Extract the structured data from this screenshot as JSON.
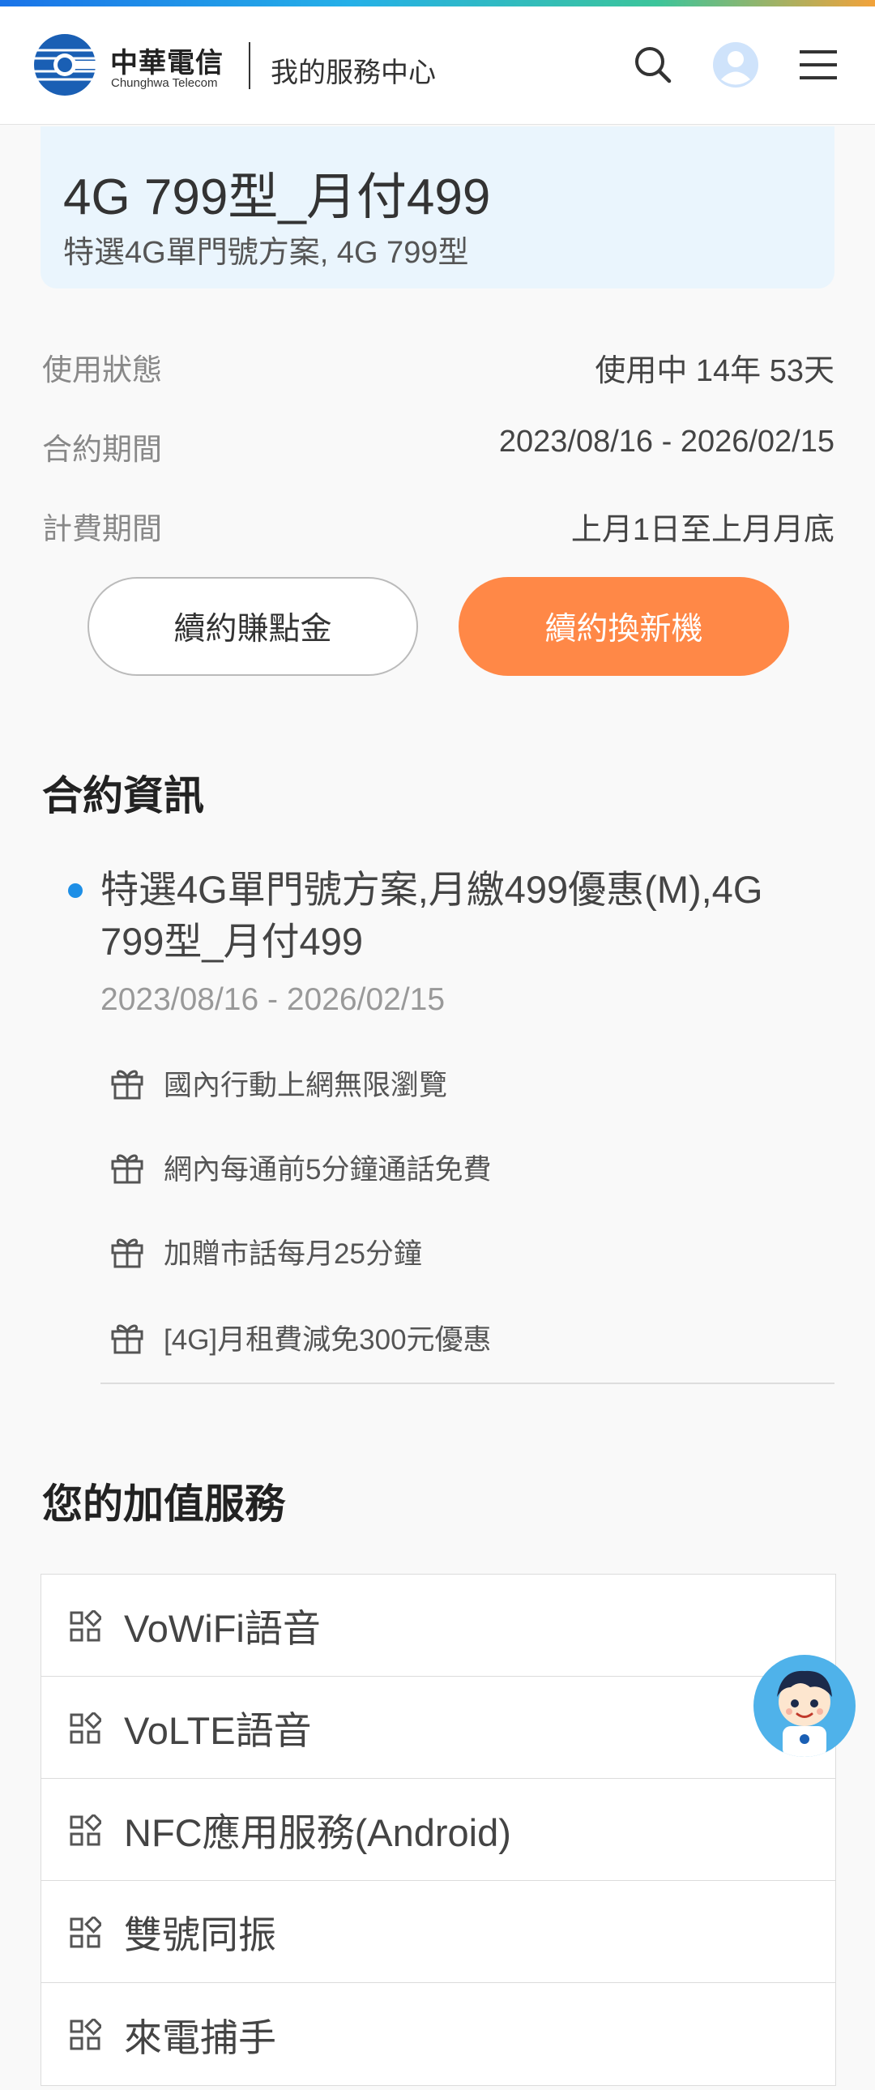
{
  "header": {
    "brand_cn": "中華電信",
    "brand_en": "Chunghwa Telecom",
    "service_center": "我的服務中心",
    "icons": [
      "search-icon",
      "user-icon",
      "menu-icon"
    ]
  },
  "plan": {
    "name": "4G 799型_月付499",
    "subtitle": "特選4G單門號方案, 4G 799型"
  },
  "info_rows": [
    {
      "label": "使用狀態",
      "value": "使用中 14年 53天"
    },
    {
      "label": "合約期間",
      "value": "2023/08/16 - 2026/02/15"
    },
    {
      "label": "計費期間",
      "value": "上月1日至上月月底"
    }
  ],
  "buttons": {
    "renew_points": "續約賺點金",
    "renew_phone": "續約換新機"
  },
  "contract": {
    "section_title": "合約資訊",
    "title": "特選4G單門號方案,月繳499優惠(M),4G 799型_月付499",
    "period": "2023/08/16 - 2026/02/15",
    "perks": [
      "國內行動上網無限瀏覽",
      "網內每通前5分鐘通話免費",
      "加贈市話每月25分鐘",
      "[4G]月租費減免300元優惠"
    ]
  },
  "vas": {
    "section_title": "您的加值服務",
    "items": [
      "VoWiFi語音",
      "VoLTE語音",
      "NFC應用服務(Android)",
      "雙號同振",
      "來電捕手"
    ]
  },
  "colors": {
    "accent_orange": "#ff8847",
    "plan_card_bg": "#eaf5fd",
    "bullet_blue": "#1e8fe6"
  }
}
